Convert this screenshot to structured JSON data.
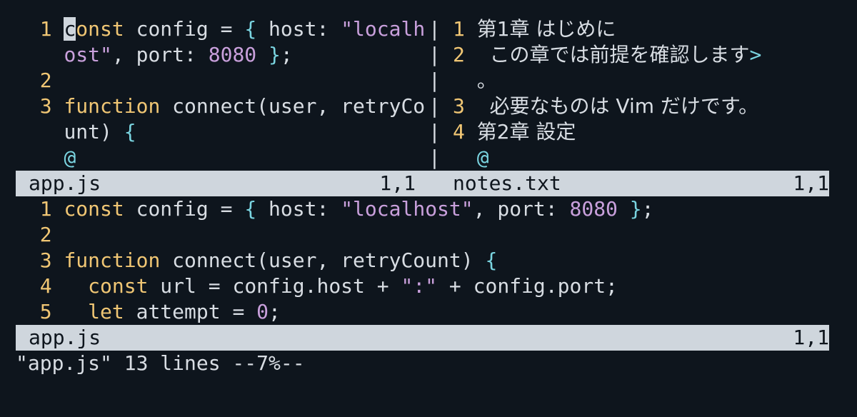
{
  "editor": "Vim",
  "top_left": {
    "filename": "app.js",
    "position": "1,1",
    "lines": [
      {
        "n": "1",
        "a1": "c",
        "a2": "onst",
        "a3": " config = ",
        "a4": "{",
        "a5": " host: ",
        "a6": "\"localh"
      },
      {
        "n": "",
        "a1": "",
        "a2": "",
        "a3": "",
        "a4": "",
        "a5": "",
        "a6": "ost\"",
        "tail1": ", port: ",
        "tail2": "8080",
        "tail3": " }",
        "tail4": ";"
      },
      {
        "n": "2"
      },
      {
        "n": "3",
        "kw": "function",
        "rest": " connect(user, retryCo"
      },
      {
        "n": "",
        "rest": "unt) ",
        "brace": "{"
      },
      {
        "n": "",
        "at": "@"
      }
    ],
    "sep_chars": [
      "|",
      "|",
      "|",
      "|",
      "|",
      "|"
    ]
  },
  "top_right": {
    "filename": "notes.txt",
    "position": "1,1",
    "lines": [
      {
        "n": "1",
        "text": "第1章 はじめに"
      },
      {
        "n": "2",
        "text": "  この章では前提を確認します",
        "wrap": ">"
      },
      {
        "n": "",
        "text": "。"
      },
      {
        "n": "3",
        "text": "  必要なものは Vim だけです。"
      },
      {
        "n": "4",
        "text": "第2章 設定"
      },
      {
        "n": "",
        "at": "@"
      }
    ]
  },
  "bottom": {
    "filename": "app.js",
    "position": "1,1",
    "lines": [
      {
        "n": "1",
        "kw": "const",
        "p1": " config = ",
        "b1": "{",
        "p2": " host: ",
        "s1": "\"localhost\"",
        "p3": ", port: ",
        "num": "8080",
        "b2": " }",
        "p4": ";"
      },
      {
        "n": "2"
      },
      {
        "n": "3",
        "kw": "function",
        "p1": " connect(user, retryCount) ",
        "b1": "{"
      },
      {
        "n": "4",
        "indent": "  ",
        "kw": "const",
        "p1": " url = config.host + ",
        "s1": "\":\"",
        "p2": " + config.port;"
      },
      {
        "n": "5",
        "indent": "  ",
        "kw": "let",
        "p1": " attempt = ",
        "num": "0",
        "p2": ";"
      }
    ]
  },
  "cmdline": "\"app.js\" 13 lines --7%--",
  "colors": {
    "background": "#0e151d",
    "line_number": "#f0c674",
    "keyword": "#f0c674",
    "string": "#c9a0dc",
    "punctuation": "#7ad4e0",
    "statusline": "#cfd6dd"
  }
}
